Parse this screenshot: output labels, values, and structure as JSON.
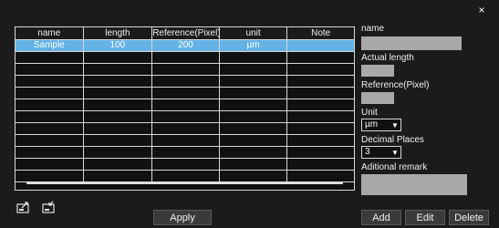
{
  "window": {
    "close_icon": "×"
  },
  "table": {
    "headers": [
      "name",
      "length",
      "Reference(Pixel)",
      "unit",
      "Note"
    ],
    "rows": [
      [
        "Sample",
        "100",
        "200",
        "µm",
        ""
      ]
    ]
  },
  "form": {
    "name_label": "name",
    "name_value": "",
    "actual_length_label": "Actual length",
    "actual_length_value": "",
    "reference_label": "Reference(Pixel)",
    "reference_value": "",
    "unit_label": "Unit",
    "unit_value": "µm",
    "decimal_label": "Decimal Places",
    "decimal_value": "3",
    "remark_label": "Aditional remark",
    "remark_value": ""
  },
  "icons": {
    "export": "export-icon",
    "import": "import-icon"
  },
  "buttons": {
    "apply": "Apply",
    "add": "Add",
    "edit": "Edit",
    "delete": "Delete"
  },
  "colors": {
    "selected_row": "#64b2e6",
    "field_bg": "#a8a8a8",
    "background": "#1b1b1b"
  }
}
